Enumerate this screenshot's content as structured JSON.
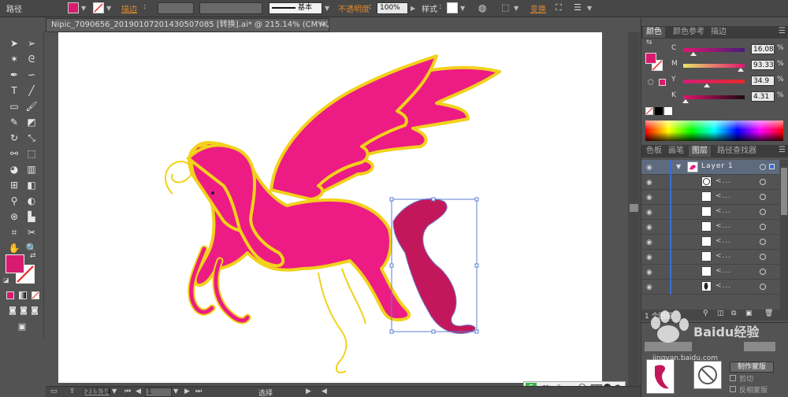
{
  "control_bar": {
    "object_type": "路径",
    "stroke_label": "描边",
    "stroke_style": "基本",
    "opacity_label": "不透明度",
    "opacity_value": "100%",
    "style_label": "样式",
    "transform_label": "变换",
    "fill_color": "#d81b6e"
  },
  "document": {
    "tab_title": "Nipic_7090656_20190107201430507085 [转换].ai* @ 215.14% (CMYK/预览)",
    "close_glyph": "×"
  },
  "status_bar": {
    "zoom": "215.14",
    "artboard": "1",
    "tool_name": "选择"
  },
  "ime": {
    "lang": "英"
  },
  "color_panel": {
    "tabs": [
      "颜色",
      "颜色参考",
      "描边"
    ],
    "active_tab": "颜色",
    "channels": [
      {
        "label": "C",
        "value": "16.08",
        "unit": "%",
        "level": 0.16
      },
      {
        "label": "M",
        "value": "93.33",
        "unit": "%",
        "level": 0.93
      },
      {
        "label": "Y",
        "value": "34.9",
        "unit": "%",
        "level": 0.35
      },
      {
        "label": "K",
        "value": "4.31",
        "unit": "%",
        "level": 0.04
      }
    ]
  },
  "layers_panel": {
    "tabs": [
      "色板",
      "画笔",
      "图层",
      "路径查找器"
    ],
    "active_tab": "图层",
    "layer_name": "Layer 1",
    "sublayer_text": "<...",
    "footer_text": "1 个图层"
  },
  "bottom_panel": {
    "make_mask": "制作蒙版",
    "clip": "剪切",
    "invert_mask": "反相蒙版"
  },
  "watermark": {
    "text": "Baidu经验",
    "url_text": "jingyan.baidu.com"
  },
  "colors": {
    "pegasus_pink": "#ec1c84",
    "tail_magenta": "#c2185b",
    "outline_yellow": "#f2d21b",
    "selection_blue": "#5b7fd6"
  }
}
